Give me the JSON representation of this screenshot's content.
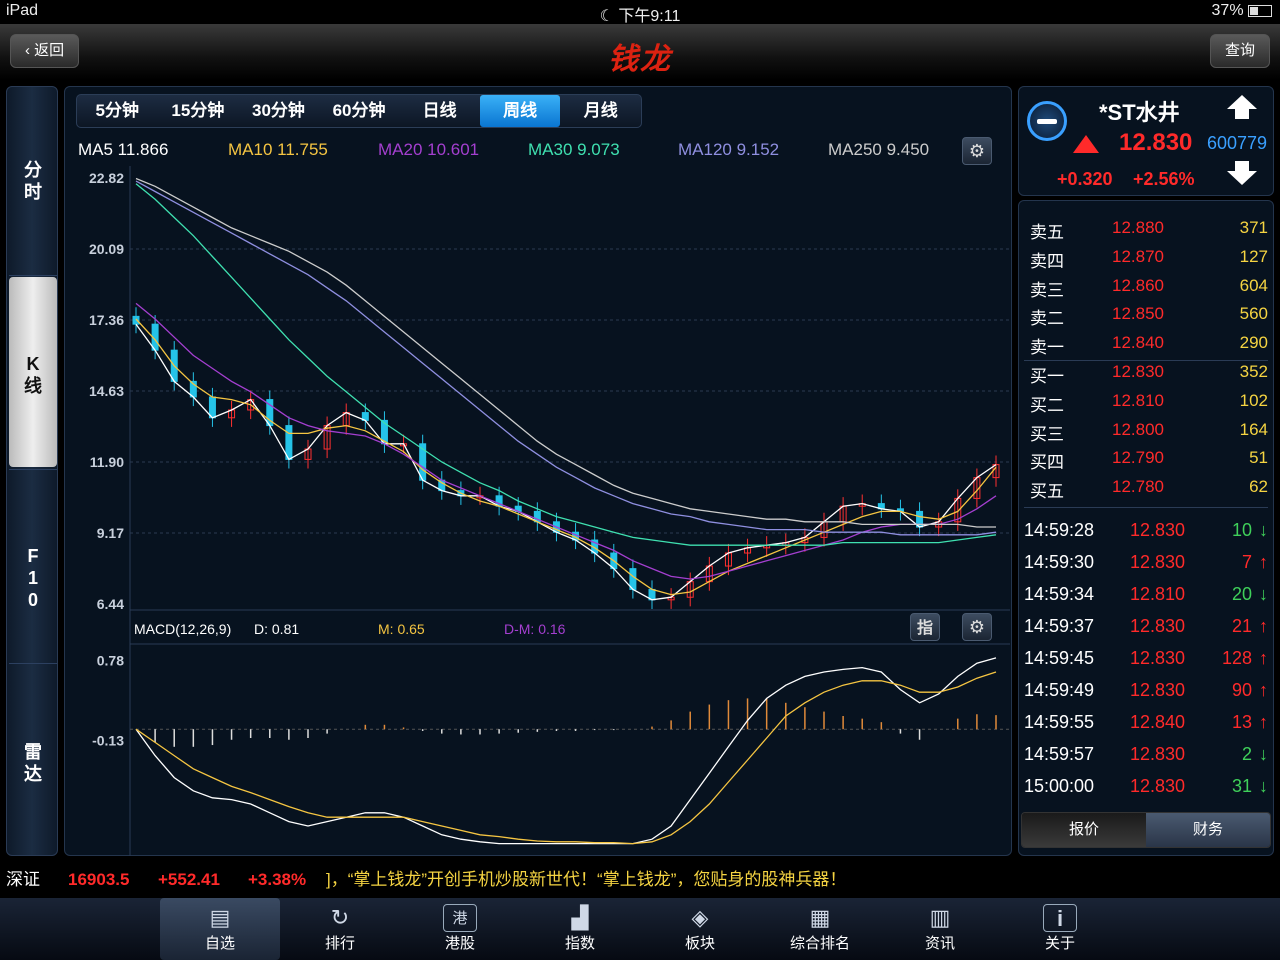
{
  "status": {
    "device": "iPad",
    "time": "下午9:11",
    "battery": "37%"
  },
  "header": {
    "back_label": "返回",
    "logo_text": "钱龙",
    "query_label": "查询"
  },
  "leftnav": {
    "items": [
      {
        "label": "分时",
        "active": false
      },
      {
        "label": "K线",
        "active": true
      },
      {
        "label": "F10",
        "active": false
      },
      {
        "label": "雷达",
        "active": false
      }
    ]
  },
  "period_tabs": [
    {
      "label": "5分钟",
      "active": false
    },
    {
      "label": "15分钟",
      "active": false
    },
    {
      "label": "30分钟",
      "active": false
    },
    {
      "label": "60分钟",
      "active": false
    },
    {
      "label": "日线",
      "active": false
    },
    {
      "label": "周线",
      "active": true
    },
    {
      "label": "月线",
      "active": false
    }
  ],
  "ma_legend": [
    {
      "label": "MA5 11.866",
      "color": "#ffffff"
    },
    {
      "label": "MA10 11.755",
      "color": "#f5c542"
    },
    {
      "label": "MA20 10.601",
      "color": "#a43fd0"
    },
    {
      "label": "MA30 9.073",
      "color": "#3fe0b0"
    },
    {
      "label": "MA120 9.152",
      "color": "#8f8fe0"
    },
    {
      "label": "MA250 9.450",
      "color": "#cccccc"
    }
  ],
  "macd_legend": {
    "title": "MACD(12,26,9)",
    "d": "D: 0.81",
    "m": "M: 0.65",
    "dm": "D-M: 0.16",
    "indicator_button": "指"
  },
  "quote": {
    "name": "*ST水井",
    "price": "12.830",
    "code": "600779",
    "change": "+0.320",
    "change_pct": "+2.56%",
    "up_color": "#ff2a2a"
  },
  "order_book": [
    {
      "label": "卖五",
      "price": "12.880",
      "vol": "371"
    },
    {
      "label": "卖四",
      "price": "12.870",
      "vol": "127"
    },
    {
      "label": "卖三",
      "price": "12.860",
      "vol": "604"
    },
    {
      "label": "卖二",
      "price": "12.850",
      "vol": "560"
    },
    {
      "label": "卖一",
      "price": "12.840",
      "vol": "290"
    },
    {
      "label": "买一",
      "price": "12.830",
      "vol": "352"
    },
    {
      "label": "买二",
      "price": "12.810",
      "vol": "102"
    },
    {
      "label": "买三",
      "price": "12.800",
      "vol": "164"
    },
    {
      "label": "买四",
      "price": "12.790",
      "vol": "51"
    },
    {
      "label": "买五",
      "price": "12.780",
      "vol": "62"
    }
  ],
  "trades": [
    {
      "time": "14:59:28",
      "price": "12.830",
      "vol": "10",
      "dir": "down"
    },
    {
      "time": "14:59:30",
      "price": "12.830",
      "vol": "7",
      "dir": "up"
    },
    {
      "time": "14:59:34",
      "price": "12.810",
      "vol": "20",
      "dir": "down"
    },
    {
      "time": "14:59:37",
      "price": "12.830",
      "vol": "21",
      "dir": "up"
    },
    {
      "time": "14:59:45",
      "price": "12.830",
      "vol": "128",
      "dir": "up"
    },
    {
      "time": "14:59:49",
      "price": "12.830",
      "vol": "90",
      "dir": "up"
    },
    {
      "time": "14:59:55",
      "price": "12.840",
      "vol": "13",
      "dir": "up"
    },
    {
      "time": "14:59:57",
      "price": "12.830",
      "vol": "2",
      "dir": "down"
    },
    {
      "time": "15:00:00",
      "price": "12.830",
      "vol": "31",
      "dir": "down"
    }
  ],
  "info_tabs": [
    {
      "label": "报价",
      "active": true
    },
    {
      "label": "财务",
      "active": false
    }
  ],
  "ticker": {
    "index_name": "深证",
    "index_value": "16903.5",
    "index_change": "+552.41",
    "index_pct": "+3.38%",
    "marquee": "]，“掌上钱龙”开创手机炒股新世代！“掌上钱龙”，您贴身的股神兵器！"
  },
  "bottom_nav": [
    {
      "label": "自选",
      "icon": "watchlist-icon",
      "active": true
    },
    {
      "label": "排行",
      "icon": "ranking-icon",
      "active": false
    },
    {
      "label": "港股",
      "icon": "hk-stock-icon",
      "active": false
    },
    {
      "label": "指数",
      "icon": "index-icon",
      "active": false
    },
    {
      "label": "板块",
      "icon": "sector-icon",
      "active": false
    },
    {
      "label": "综合排名",
      "icon": "composite-rank-icon",
      "active": false
    },
    {
      "label": "资讯",
      "icon": "news-icon",
      "active": false
    },
    {
      "label": "关于",
      "icon": "about-icon",
      "active": false
    }
  ],
  "chart_data": [
    {
      "type": "candlestick",
      "ytick_labels": [
        "22.82",
        "20.09",
        "17.36",
        "14.63",
        "11.90",
        "9.17",
        "6.44"
      ],
      "ylim": [
        6.44,
        22.82
      ],
      "grid": true,
      "series": [
        {
          "name": "MA5",
          "values": [
            17.2,
            16.2,
            15.0,
            14.4,
            13.6,
            13.9,
            14.3,
            13.3,
            12.0,
            12.4,
            13.3,
            13.8,
            13.5,
            12.6,
            12.6,
            11.2,
            10.8,
            10.6,
            10.6,
            10.2,
            10.0,
            9.6,
            9.2,
            8.9,
            8.4,
            7.8,
            7.0,
            6.6,
            6.7,
            7.3,
            7.9,
            8.4,
            8.6,
            8.7,
            8.8,
            9.0,
            9.6,
            10.2,
            10.3,
            10.1,
            10.0,
            9.4,
            9.6,
            10.5,
            11.3,
            11.8
          ]
        },
        {
          "name": "MA10",
          "values": [
            17.4,
            16.6,
            15.6,
            14.9,
            14.4,
            14.3,
            14.1,
            13.5,
            13.0,
            13.0,
            13.2,
            13.3,
            13.1,
            12.7,
            12.3,
            11.6,
            11.1,
            10.7,
            10.4,
            10.2,
            9.9,
            9.6,
            9.3,
            9.0,
            8.6,
            8.1,
            7.5,
            7.0,
            6.8,
            6.9,
            7.3,
            7.7,
            8.0,
            8.3,
            8.6,
            8.9,
            9.2,
            9.5,
            9.8,
            10.0,
            10.0,
            9.8,
            9.7,
            10.0,
            10.8,
            11.7
          ]
        },
        {
          "name": "MA20",
          "values": [
            18.0,
            17.4,
            16.7,
            16.0,
            15.5,
            15.0,
            14.6,
            14.1,
            13.6,
            13.3,
            13.1,
            13.0,
            12.9,
            12.6,
            12.2,
            11.7,
            11.2,
            10.9,
            10.6,
            10.3,
            10.0,
            9.7,
            9.4,
            9.1,
            8.8,
            8.5,
            8.1,
            7.8,
            7.5,
            7.4,
            7.5,
            7.7,
            7.9,
            8.1,
            8.3,
            8.5,
            8.7,
            8.9,
            9.2,
            9.4,
            9.5,
            9.5,
            9.5,
            9.7,
            10.1,
            10.6
          ]
        },
        {
          "name": "MA30",
          "values": [
            22.6,
            22.0,
            21.3,
            20.6,
            19.8,
            19.0,
            18.2,
            17.4,
            16.6,
            15.9,
            15.2,
            14.6,
            14.0,
            13.4,
            12.9,
            12.4,
            11.9,
            11.5,
            11.1,
            10.8,
            10.4,
            10.1,
            9.8,
            9.6,
            9.4,
            9.2,
            9.0,
            8.9,
            8.8,
            8.7,
            8.7,
            8.7,
            8.7,
            8.7,
            8.7,
            8.7,
            8.7,
            8.8,
            8.8,
            8.8,
            8.8,
            8.8,
            8.8,
            8.9,
            9.0,
            9.1
          ]
        },
        {
          "name": "MA120",
          "values": [
            22.7,
            22.3,
            21.9,
            21.5,
            21.1,
            20.7,
            20.3,
            19.9,
            19.5,
            19.1,
            18.6,
            18.1,
            17.5,
            16.9,
            16.3,
            15.7,
            15.1,
            14.5,
            13.9,
            13.3,
            12.7,
            12.2,
            11.7,
            11.3,
            10.9,
            10.6,
            10.3,
            10.1,
            9.9,
            9.8,
            9.6,
            9.5,
            9.4,
            9.3,
            9.3,
            9.3,
            9.2,
            9.2,
            9.2,
            9.2,
            9.1,
            9.1,
            9.1,
            9.1,
            9.1,
            9.2
          ]
        },
        {
          "name": "MA250",
          "values": [
            22.8,
            22.5,
            22.1,
            21.7,
            21.3,
            20.9,
            20.6,
            20.3,
            20.0,
            19.6,
            19.2,
            18.7,
            18.1,
            17.5,
            16.9,
            16.3,
            15.7,
            15.1,
            14.5,
            13.9,
            13.3,
            12.7,
            12.2,
            11.8,
            11.4,
            11.0,
            10.7,
            10.5,
            10.3,
            10.1,
            10.0,
            9.9,
            9.8,
            9.7,
            9.7,
            9.6,
            9.6,
            9.6,
            9.5,
            9.5,
            9.5,
            9.5,
            9.5,
            9.5,
            9.4,
            9.4
          ]
        }
      ]
    },
    {
      "type": "bar",
      "title": "MACD(12,26,9)",
      "ytick_labels": [
        "0.78",
        "-0.13"
      ],
      "series": [
        {
          "name": "D",
          "values": [
            0.0,
            -0.3,
            -0.55,
            -0.7,
            -0.78,
            -0.8,
            -0.85,
            -0.95,
            -1.05,
            -1.1,
            -1.05,
            -1.0,
            -0.95,
            -0.95,
            -1.0,
            -1.1,
            -1.2,
            -1.25,
            -1.28,
            -1.3,
            -1.3,
            -1.3,
            -1.3,
            -1.3,
            -1.3,
            -1.3,
            -1.3,
            -1.25,
            -1.1,
            -0.8,
            -0.5,
            -0.2,
            0.1,
            0.35,
            0.5,
            0.6,
            0.65,
            0.68,
            0.7,
            0.65,
            0.45,
            0.3,
            0.4,
            0.6,
            0.75,
            0.81
          ]
        },
        {
          "name": "M",
          "values": [
            0.0,
            -0.15,
            -0.3,
            -0.45,
            -0.55,
            -0.65,
            -0.72,
            -0.8,
            -0.88,
            -0.95,
            -1.0,
            -1.0,
            -1.0,
            -1.0,
            -1.0,
            -1.05,
            -1.1,
            -1.15,
            -1.2,
            -1.22,
            -1.25,
            -1.27,
            -1.28,
            -1.28,
            -1.29,
            -1.29,
            -1.3,
            -1.28,
            -1.2,
            -1.05,
            -0.85,
            -0.6,
            -0.35,
            -0.1,
            0.15,
            0.3,
            0.42,
            0.5,
            0.55,
            0.55,
            0.5,
            0.42,
            0.42,
            0.48,
            0.58,
            0.65
          ]
        },
        {
          "name": "D-M",
          "values": [
            0.0,
            -0.15,
            -0.2,
            -0.2,
            -0.18,
            -0.12,
            -0.1,
            -0.1,
            -0.12,
            -0.1,
            -0.05,
            0.0,
            0.05,
            0.05,
            0.02,
            -0.02,
            -0.05,
            -0.06,
            -0.06,
            -0.05,
            -0.04,
            -0.03,
            -0.02,
            -0.02,
            -0.01,
            -0.01,
            0.0,
            0.03,
            0.1,
            0.2,
            0.28,
            0.33,
            0.35,
            0.35,
            0.3,
            0.25,
            0.2,
            0.15,
            0.12,
            0.08,
            -0.05,
            -0.12,
            0.0,
            0.12,
            0.17,
            0.16
          ]
        }
      ]
    }
  ]
}
